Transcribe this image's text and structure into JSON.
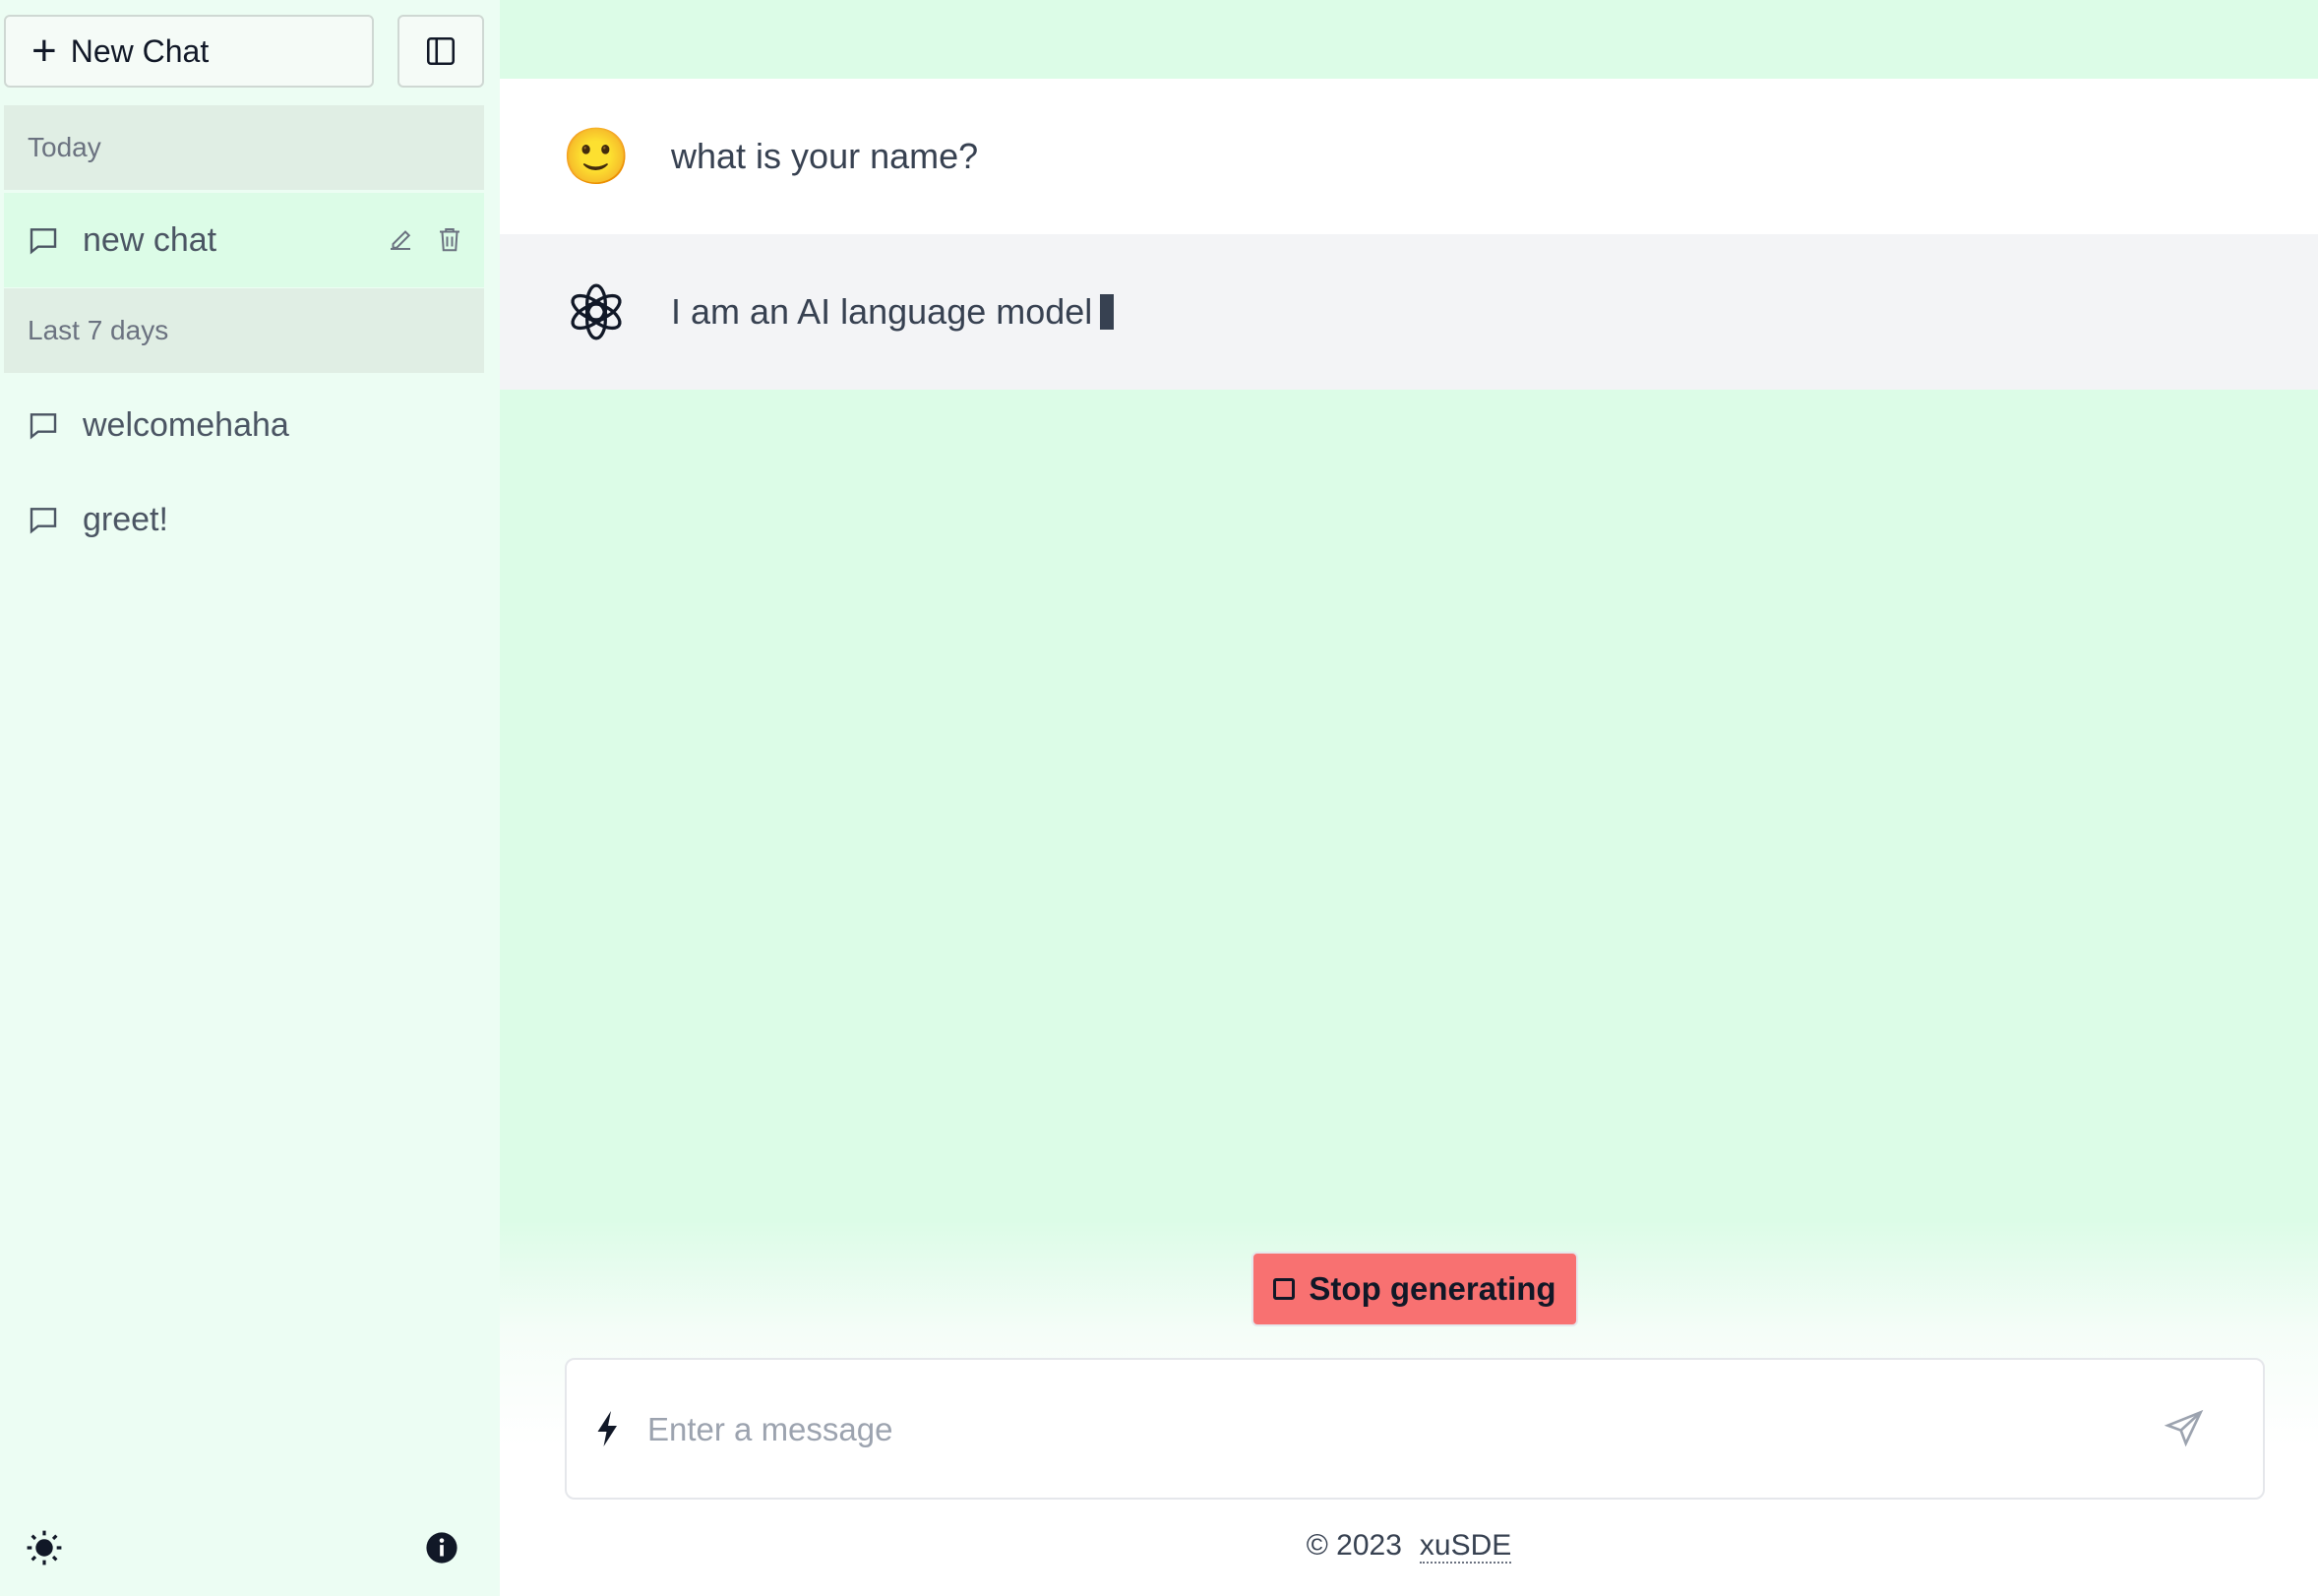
{
  "sidebar": {
    "new_chat_label": "New Chat",
    "groups": [
      {
        "label": "Today"
      },
      {
        "label": "Last 7 days"
      }
    ],
    "chats": [
      {
        "label": "new chat",
        "active": true
      },
      {
        "label": "welcomehaha"
      },
      {
        "label": "greet!"
      }
    ]
  },
  "messages": [
    {
      "role": "user",
      "avatar": "🙂",
      "text": "what is your name?"
    },
    {
      "role": "assistant",
      "avatar": "openai-logo-icon",
      "text": "I am an AI language model"
    }
  ],
  "stop_button_label": "Stop generating",
  "input": {
    "placeholder": "Enter a message",
    "value": ""
  },
  "footer": {
    "copyright": "© 2023",
    "link_text": "xuSDE"
  },
  "colors": {
    "main_bg": "#dcfce7",
    "sidebar_bg": "#ecfdf3",
    "stop_button": "#f87171",
    "active_item": "#dcfce7"
  }
}
